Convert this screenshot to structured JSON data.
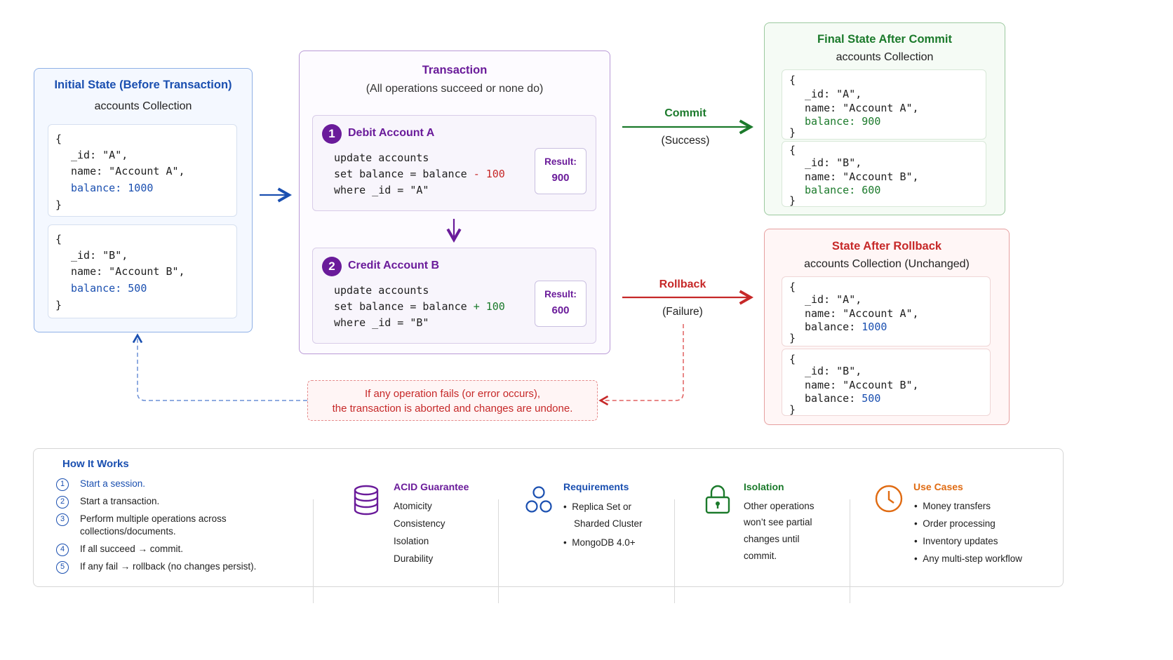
{
  "initial": {
    "title": "Initial State (Before Transaction)",
    "subtitle": "accounts Collection",
    "docA": {
      "open": "{",
      "id": "_id: \"A\",",
      "name": "name: \"Account A\",",
      "balance_key": "balance:",
      "balance_val": "1000",
      "close": "}"
    },
    "docB": {
      "open": "{",
      "id": "_id: \"B\",",
      "name": "name: \"Account B\",",
      "balance_key": "balance:",
      "balance_val": "500",
      "close": "}"
    }
  },
  "transaction": {
    "title": "Transaction",
    "subtitle": "(All operations succeed or none do)",
    "step1": {
      "num": "1",
      "title": "Debit Account A",
      "line1": "update accounts",
      "line2_pre": "set balance = balance",
      "line2_op": "- 100",
      "line3": "where _id = \"A\"",
      "result_label": "Result:",
      "result_value": "900"
    },
    "step2": {
      "num": "2",
      "title": "Credit Account B",
      "line1": "update accounts",
      "line2_pre": "set balance = balance",
      "line2_op": "+ 100",
      "line3": "where _id = \"B\"",
      "result_label": "Result:",
      "result_value": "600"
    }
  },
  "commit": {
    "label": "Commit",
    "sub": "(Success)"
  },
  "rollback": {
    "label": "Rollback",
    "sub": "(Failure)"
  },
  "error_note": {
    "line1": "If any operation fails (or error occurs),",
    "line2": "the transaction is aborted and changes are undone."
  },
  "final": {
    "title": "Final State After Commit",
    "subtitle": "accounts Collection",
    "docA": {
      "open": "{",
      "id": "_id: \"A\",",
      "name": "name: \"Account A\",",
      "balance_key": "balance:",
      "balance_val": "900",
      "close": "}"
    },
    "docB": {
      "open": "{",
      "id": "_id: \"B\",",
      "name": "name: \"Account B\",",
      "balance_key": "balance:",
      "balance_val": "600",
      "close": "}"
    }
  },
  "rolled": {
    "title": "State After Rollback",
    "subtitle": "accounts Collection (Unchanged)",
    "docA": {
      "open": "{",
      "id": "_id: \"A\",",
      "name": "name: \"Account A\",",
      "balance_key": "balance:",
      "balance_val": "1000",
      "close": "}"
    },
    "docB": {
      "open": "{",
      "id": "_id: \"B\",",
      "name": "name: \"Account B\",",
      "balance_key": "balance:",
      "balance_val": "500",
      "close": "}"
    }
  },
  "how": {
    "title": "How It Works",
    "steps": [
      {
        "num": "1",
        "text": "Start a session."
      },
      {
        "num": "2",
        "text": "Start a transaction."
      },
      {
        "num": "3",
        "text": "Perform multiple operations across",
        "text2": "collections/documents."
      },
      {
        "num": "4",
        "text": "If all succeed → commit."
      },
      {
        "num": "5",
        "text": "If any fail → rollback (no changes persist)."
      }
    ]
  },
  "acid": {
    "icon": "database-icon",
    "title": "ACID Guarantee",
    "items": [
      "Atomicity",
      "Consistency",
      "Isolation",
      "Durability"
    ]
  },
  "requirements": {
    "icon": "replica-set-icon",
    "title": "Requirements",
    "items": [
      "Replica Set or",
      "Sharded Cluster",
      "MongoDB 4.0+"
    ]
  },
  "isolation": {
    "icon": "lock-icon",
    "title": "Isolation",
    "lines": [
      "Other operations",
      "won’t see partial",
      "changes until",
      "commit."
    ]
  },
  "usecases": {
    "icon": "clock-icon",
    "title": "Use Cases",
    "items": [
      "Money transfers",
      "Order processing",
      "Inventory updates",
      "Any multi-step workflow"
    ]
  },
  "colors": {
    "blue": "#1a4fb0",
    "purple": "#6a1b9a",
    "green": "#1b7a2b",
    "red": "#c62828",
    "orange": "#e06b12"
  }
}
